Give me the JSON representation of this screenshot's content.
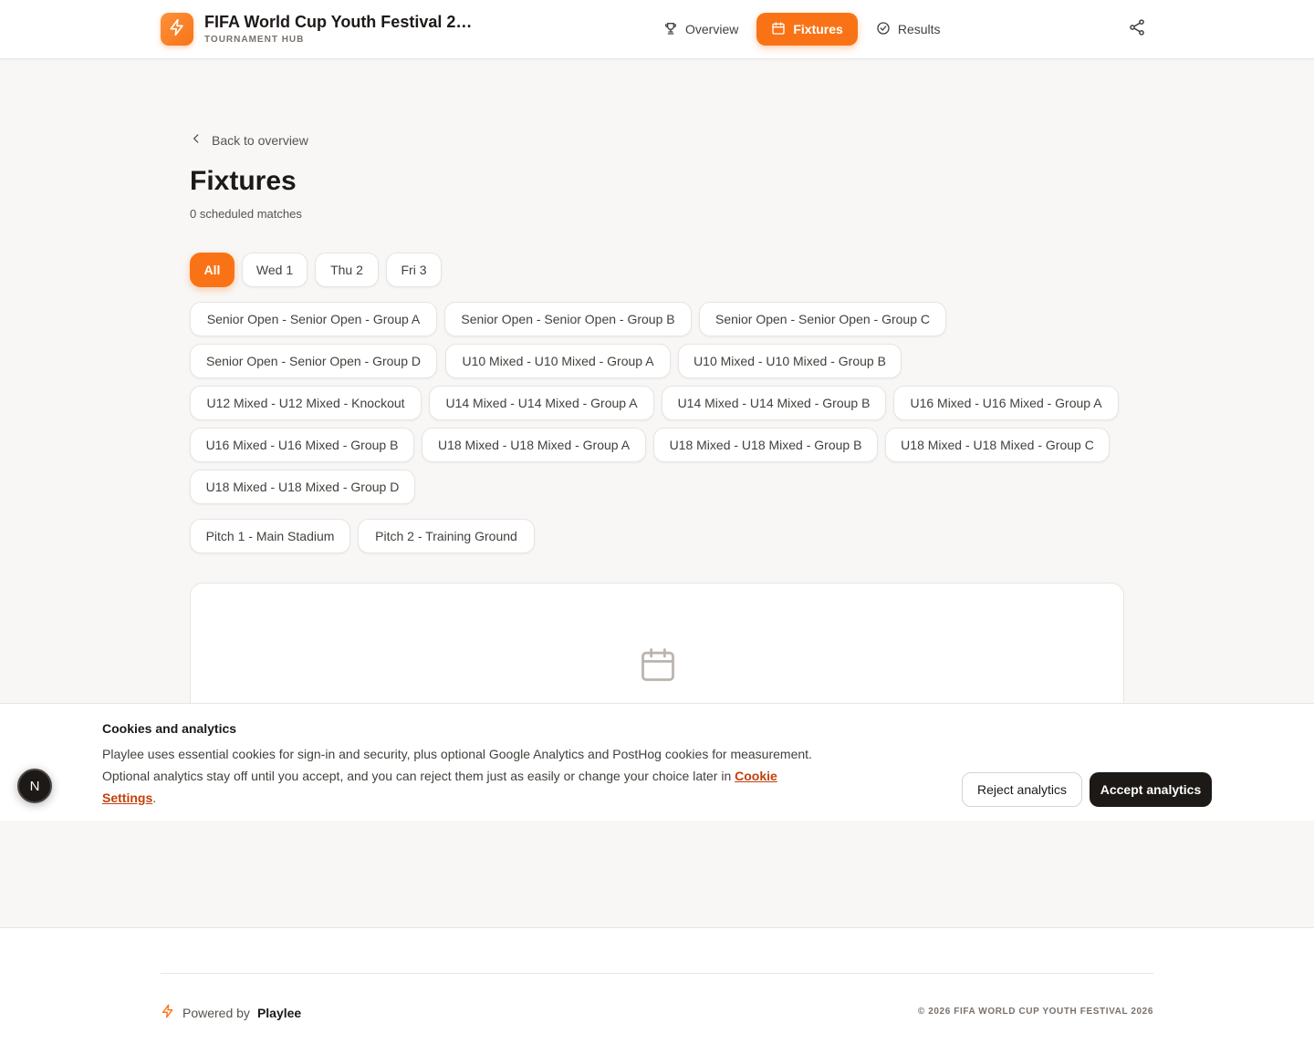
{
  "header": {
    "title": "FIFA World Cup Youth Festival 20...",
    "subtitle": "TOURNAMENT HUB",
    "logo_icon": "bolt-icon",
    "nav": [
      {
        "label": "Overview",
        "icon": "trophy-icon"
      },
      {
        "label": "Fixtures",
        "icon": "calendar-icon",
        "active": true
      },
      {
        "label": "Results",
        "icon": "check-circle-icon"
      }
    ],
    "share_icon": "share-icon"
  },
  "main": {
    "back_label": "Back to overview",
    "title": "Fixtures",
    "match_count": "0 scheduled matches",
    "day_filters": [
      "All",
      "Wed 1",
      "Thu 2",
      "Fri 3"
    ],
    "group_filters": [
      "Senior Open - Senior Open - Group A",
      "Senior Open - Senior Open - Group B",
      "Senior Open - Senior Open - Group C",
      "Senior Open - Senior Open - Group D",
      "U10 Mixed - U10 Mixed - Group A",
      "U10 Mixed - U10 Mixed - Group B",
      "U12 Mixed - U12 Mixed - Knockout",
      "U14 Mixed - U14 Mixed - Group A",
      "U14 Mixed - U14 Mixed - Group B",
      "U16 Mixed - U16 Mixed - Group A",
      "U16 Mixed - U16 Mixed - Group B",
      "U18 Mixed - U18 Mixed - Group A",
      "U18 Mixed - U18 Mixed - Group B",
      "U18 Mixed - U18 Mixed - Group C",
      "U18 Mixed - U18 Mixed - Group D"
    ],
    "pitch_filters": [
      "Pitch 1 - Main Stadium",
      "Pitch 2 - Training Ground"
    ],
    "empty_icon": "calendar-icon"
  },
  "cookie": {
    "title": "Cookies and analytics",
    "body": "Playlee uses essential cookies for sign-in and security, plus optional Google Analytics and PostHog cookies for measurement. Optional analytics stay off until you accept, and you can reject them just as easily or change your choice later in ",
    "link": "Cookie Settings",
    "end": ".",
    "reject": "Reject analytics",
    "accept": "Accept analytics"
  },
  "dev_badge": "N",
  "footer": {
    "powered_prefix": "Powered by",
    "powered_brand": "Playlee",
    "copyright": "© 2026 FIFA WORLD CUP YOUTH FESTIVAL 2026"
  },
  "colors": {
    "accent": "#f97316",
    "text": "#1c1917",
    "background": "#f8f7f5"
  }
}
